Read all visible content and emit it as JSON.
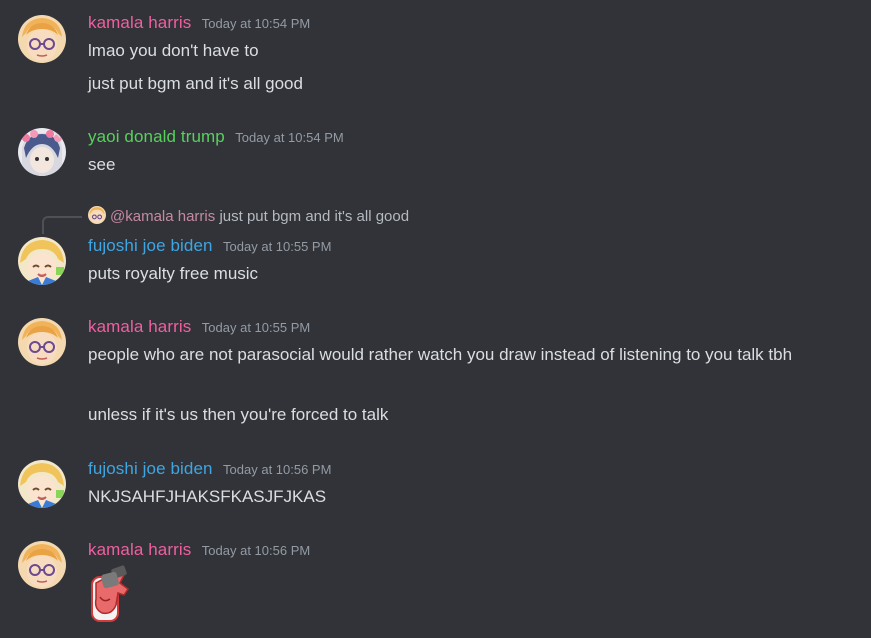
{
  "colors": {
    "background": "#313338",
    "pink_user": "#f05fa0",
    "green_user": "#57d15d",
    "blue_user": "#3ea6e3",
    "text": "#dbdee1",
    "muted": "#949ba4"
  },
  "messages": [
    {
      "user": "kamala harris",
      "time": "Today at 10:54 PM",
      "lines": [
        "lmao you don't have to",
        "just put bgm and it's all good"
      ]
    },
    {
      "user": "yaoi donald trump",
      "time": "Today at 10:54 PM",
      "lines": [
        "see"
      ]
    },
    {
      "reply": {
        "mention": "@kamala harris",
        "text": "just put bgm and it's all good"
      },
      "user": "fujoshi joe biden",
      "time": "Today at 10:55 PM",
      "lines": [
        "puts royalty free music"
      ]
    },
    {
      "user": "kamala harris",
      "time": "Today at 10:55 PM",
      "lines": [
        "people who are not parasocial would rather watch you draw instead of listening to you talk tbh",
        "unless if it's us then you're forced to talk"
      ]
    },
    {
      "user": "fujoshi joe biden",
      "time": "Today at 10:56 PM",
      "lines": [
        "NKJSAHFJHAKSFKASJFJKAS"
      ]
    },
    {
      "user": "kamala harris",
      "time": "Today at 10:56 PM",
      "emoji": "finger-gun-emoji"
    }
  ]
}
